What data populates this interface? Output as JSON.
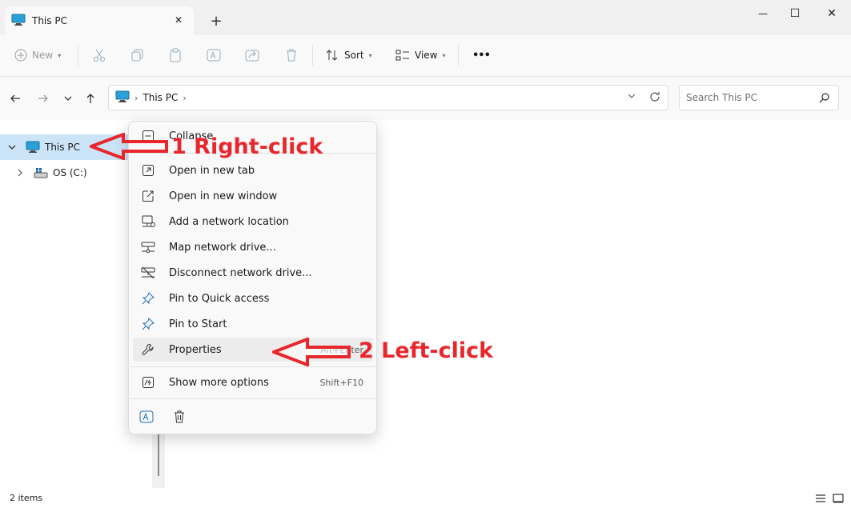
{
  "window": {
    "tab_title": "This PC",
    "tab_close_glyph": "✕",
    "new_tab_glyph": "+",
    "minimize_glyph": "—",
    "maximize_glyph": "☐",
    "close_glyph": "✕"
  },
  "toolbar": {
    "new_label": "New",
    "sort_label": "Sort",
    "view_label": "View",
    "more_glyph": "•••"
  },
  "address": {
    "location": "This PC",
    "search_placeholder": "Search This PC"
  },
  "navpane": {
    "items": [
      {
        "label": "This PC",
        "icon": "computer-icon",
        "expanded": true,
        "selected": true
      },
      {
        "label": "OS (C:)",
        "icon": "drive-icon",
        "expanded": false,
        "selected": false
      }
    ]
  },
  "context_menu": {
    "items": [
      {
        "label": "Collapse",
        "icon": "collapse-icon",
        "shortcut": ""
      },
      {
        "label": "Open in new tab",
        "icon": "open-tab-icon",
        "shortcut": ""
      },
      {
        "label": "Open in new window",
        "icon": "open-window-icon",
        "shortcut": ""
      },
      {
        "label": "Add a network location",
        "icon": "network-location-icon",
        "shortcut": ""
      },
      {
        "label": "Map network drive...",
        "icon": "map-drive-icon",
        "shortcut": ""
      },
      {
        "label": "Disconnect network drive...",
        "icon": "disconnect-drive-icon",
        "shortcut": ""
      },
      {
        "label": "Pin to Quick access",
        "icon": "pin-icon",
        "shortcut": ""
      },
      {
        "label": "Pin to Start",
        "icon": "pin-icon",
        "shortcut": ""
      },
      {
        "label": "Properties",
        "icon": "wrench-icon",
        "shortcut": "Alt+Enter"
      },
      {
        "label": "Show more options",
        "icon": "more-options-icon",
        "shortcut": "Shift+F10"
      }
    ],
    "bottom_icons": [
      "rename-icon",
      "delete-icon"
    ]
  },
  "annotations": {
    "step1": "1 Right-click",
    "step2": "2 Left-click",
    "color": "#e8272c"
  },
  "status": {
    "item_count": "2 items"
  },
  "colors": {
    "accent": "#0067c0",
    "selection": "#cce4f7",
    "annotation": "#e8272c"
  }
}
